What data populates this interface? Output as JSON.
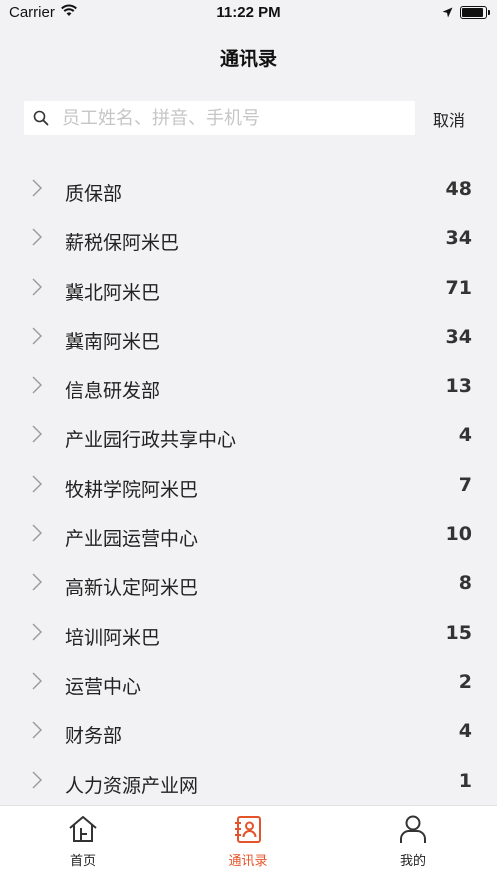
{
  "status": {
    "carrier": "Carrier",
    "time": "11:22 PM"
  },
  "nav": {
    "title": "通讯录"
  },
  "search": {
    "placeholder": "员工姓名、拼音、手机号",
    "cancel_label": "取消"
  },
  "departments": [
    {
      "name": "质保部",
      "count": "48"
    },
    {
      "name": "薪税保阿米巴",
      "count": "34"
    },
    {
      "name": "冀北阿米巴",
      "count": "71"
    },
    {
      "name": "冀南阿米巴",
      "count": "34"
    },
    {
      "name": "信息研发部",
      "count": "13"
    },
    {
      "name": "产业园行政共享中心",
      "count": "4"
    },
    {
      "name": "牧耕学院阿米巴",
      "count": "7"
    },
    {
      "name": "产业园运营中心",
      "count": "10"
    },
    {
      "name": "高新认定阿米巴",
      "count": "8"
    },
    {
      "name": "培训阿米巴",
      "count": "15"
    },
    {
      "name": "运营中心",
      "count": "2"
    },
    {
      "name": "财务部",
      "count": "4"
    },
    {
      "name": "人力资源产业网",
      "count": "1"
    }
  ],
  "tabs": [
    {
      "label": "首页",
      "icon": "home-icon"
    },
    {
      "label": "通讯录",
      "icon": "contacts-icon",
      "active": true
    },
    {
      "label": "我的",
      "icon": "person-icon"
    }
  ],
  "colors": {
    "accent": "#e4542a",
    "background": "#f2f2f4"
  }
}
